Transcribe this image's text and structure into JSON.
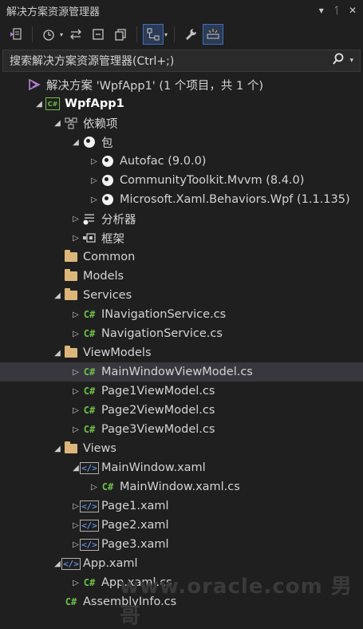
{
  "titlebar": {
    "title": "解决方案资源管理器",
    "dropdown_glyph": "▾",
    "pin_glyph": "ᛐ",
    "close_glyph": "✕"
  },
  "toolbar": {
    "drop1": "▾",
    "drop2": "▾"
  },
  "search": {
    "placeholder": "搜索解决方案资源管理器(Ctrl+;)"
  },
  "tree": [
    {
      "name": "solution-node",
      "icon": "solution-icon",
      "toggle": "",
      "indent": 0,
      "label": "解决方案 'WpfApp1' (1 个项目，共 1 个)"
    },
    {
      "name": "project-node",
      "icon": "csharp-project-icon",
      "toggle": "◢",
      "indent": 1,
      "label": "WpfApp1",
      "bold": true
    },
    {
      "name": "dependencies-node",
      "icon": "dependencies-icon",
      "toggle": "◢",
      "indent": 2,
      "label": "依赖项"
    },
    {
      "name": "packages-node",
      "icon": "package-icon",
      "toggle": "◢",
      "indent": 3,
      "label": "包"
    },
    {
      "name": "package-autofac",
      "icon": "package-icon",
      "toggle": "▷",
      "indent": 4,
      "label": "Autofac (9.0.0)"
    },
    {
      "name": "package-mvvm",
      "icon": "package-icon",
      "toggle": "▷",
      "indent": 4,
      "label": "CommunityToolkit.Mvvm (8.4.0)"
    },
    {
      "name": "package-behaviors",
      "icon": "package-icon",
      "toggle": "▷",
      "indent": 4,
      "label": "Microsoft.Xaml.Behaviors.Wpf (1.1.135)"
    },
    {
      "name": "analyzers-node",
      "icon": "analyzer-icon",
      "toggle": "▷",
      "indent": 3,
      "label": "分析器"
    },
    {
      "name": "frameworks-node",
      "icon": "framework-icon",
      "toggle": "▷",
      "indent": 3,
      "label": "框架"
    },
    {
      "name": "folder-common",
      "icon": "folder-icon",
      "toggle": "",
      "indent": 2,
      "label": "Common"
    },
    {
      "name": "folder-models",
      "icon": "folder-icon",
      "toggle": "",
      "indent": 2,
      "label": "Models"
    },
    {
      "name": "folder-services",
      "icon": "folder-icon",
      "toggle": "◢",
      "indent": 2,
      "label": "Services"
    },
    {
      "name": "file-inavigationservice",
      "icon": "csharp-file-icon",
      "toggle": "▷",
      "indent": 3,
      "label": "INavigationService.cs"
    },
    {
      "name": "file-navigationservice",
      "icon": "csharp-file-icon",
      "toggle": "▷",
      "indent": 3,
      "label": "NavigationService.cs"
    },
    {
      "name": "folder-viewmodels",
      "icon": "folder-icon",
      "toggle": "◢",
      "indent": 2,
      "label": "ViewModels"
    },
    {
      "name": "file-mainwindowviewmodel",
      "icon": "csharp-file-icon",
      "toggle": "▷",
      "indent": 3,
      "label": "MainWindowViewModel.cs",
      "selected": true
    },
    {
      "name": "file-page1viewmodel",
      "icon": "csharp-file-icon",
      "toggle": "▷",
      "indent": 3,
      "label": "Page1ViewModel.cs"
    },
    {
      "name": "file-page2viewmodel",
      "icon": "csharp-file-icon",
      "toggle": "▷",
      "indent": 3,
      "label": "Page2ViewModel.cs"
    },
    {
      "name": "file-page3viewmodel",
      "icon": "csharp-file-icon",
      "toggle": "▷",
      "indent": 3,
      "label": "Page3ViewModel.cs"
    },
    {
      "name": "folder-views",
      "icon": "folder-icon",
      "toggle": "◢",
      "indent": 2,
      "label": "Views"
    },
    {
      "name": "file-mainwindow-xaml",
      "icon": "xaml-file-icon",
      "toggle": "◢",
      "indent": 3,
      "label": "MainWindow.xaml"
    },
    {
      "name": "file-mainwindow-xaml-cs",
      "icon": "csharp-file-icon",
      "toggle": "▷",
      "indent": 4,
      "label": "MainWindow.xaml.cs"
    },
    {
      "name": "file-page1-xaml",
      "icon": "xaml-file-icon",
      "toggle": "▷",
      "indent": 3,
      "label": "Page1.xaml"
    },
    {
      "name": "file-page2-xaml",
      "icon": "xaml-file-icon",
      "toggle": "▷",
      "indent": 3,
      "label": "Page2.xaml"
    },
    {
      "name": "file-page3-xaml",
      "icon": "xaml-file-icon",
      "toggle": "▷",
      "indent": 3,
      "label": "Page3.xaml"
    },
    {
      "name": "file-app-xaml",
      "icon": "xaml-file-icon",
      "toggle": "◢",
      "indent": 2,
      "label": "App.xaml"
    },
    {
      "name": "file-app-xaml-cs",
      "icon": "csharp-file-icon",
      "toggle": "▷",
      "indent": 3,
      "label": "App.xaml.cs"
    },
    {
      "name": "file-assemblyinfo",
      "icon": "csharp-file-icon",
      "toggle": "",
      "indent": 2,
      "label": "AssemblyInfo.cs"
    }
  ],
  "watermark": "www.oracle.com 男哥"
}
